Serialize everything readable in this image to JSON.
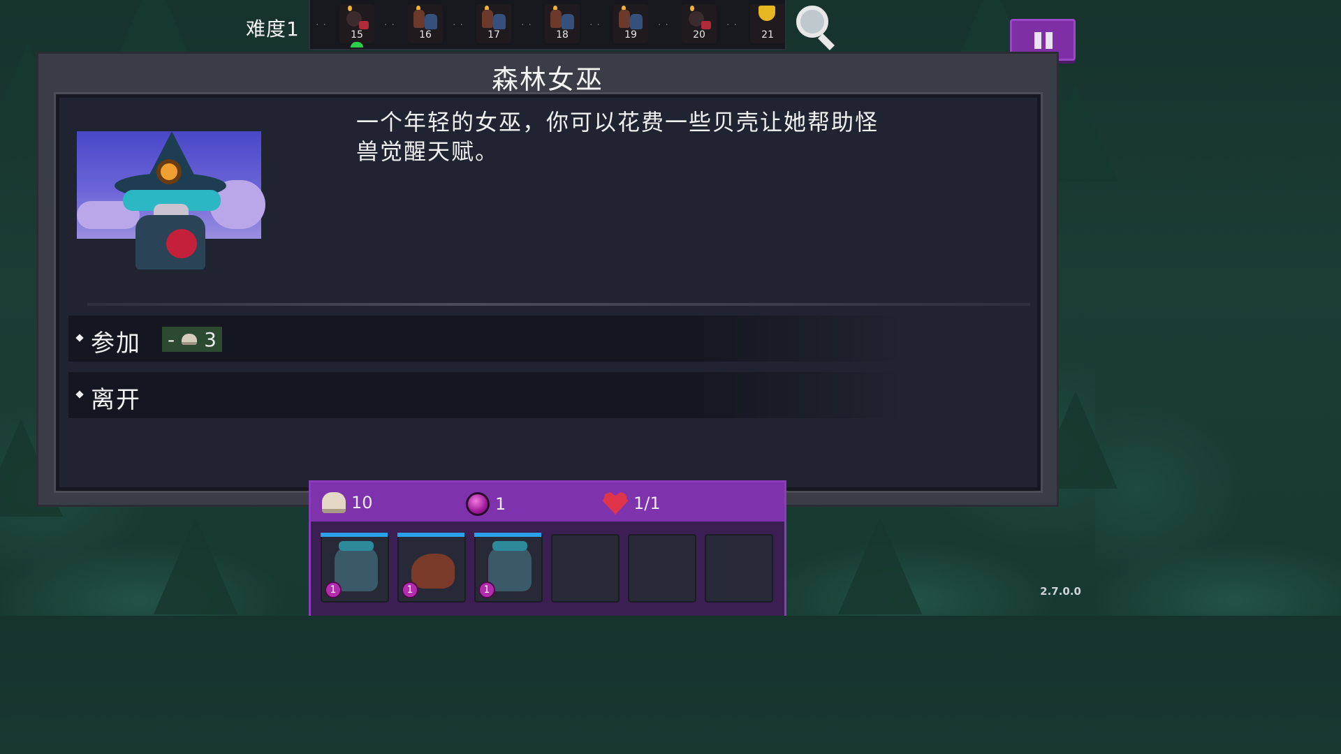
{
  "header": {
    "difficulty_label": "难度1",
    "waves": [
      {
        "number": "15",
        "kind": "bomb",
        "current": true
      },
      {
        "number": "16",
        "kind": "enemies",
        "current": false
      },
      {
        "number": "17",
        "kind": "enemies",
        "current": false
      },
      {
        "number": "18",
        "kind": "enemies",
        "current": false
      },
      {
        "number": "19",
        "kind": "enemies",
        "current": false
      },
      {
        "number": "20",
        "kind": "bomb",
        "current": false
      },
      {
        "number": "21",
        "kind": "trophy",
        "current": false
      }
    ],
    "search_icon": "magnifier-icon",
    "pause_icon": "pause-icon"
  },
  "event": {
    "title": "森林女巫",
    "description_line1": "一个年轻的女巫，你可以花费一些贝壳让她帮助怪",
    "description_line2": "兽觉醒天赋。",
    "portrait": "forest-witch-portrait",
    "options": [
      {
        "label": "参加",
        "cost_prefix": "-",
        "cost_value": "3",
        "cost_icon": "shell-icon"
      },
      {
        "label": "离开"
      }
    ]
  },
  "inventory": {
    "shells": "10",
    "orbs": "1",
    "lives": "1/1",
    "slots": [
      {
        "occupied": true,
        "creature": "spiky-beast",
        "level": "1",
        "hp": 1.0
      },
      {
        "occupied": true,
        "creature": "boar",
        "level": "1",
        "hp": 1.0
      },
      {
        "occupied": true,
        "creature": "spiky-beast-vine",
        "level": "1",
        "hp": 1.0
      },
      {
        "occupied": false
      },
      {
        "occupied": false
      },
      {
        "occupied": false
      }
    ]
  },
  "version": "2.7.0.0",
  "colors": {
    "panel": "#3a3c46",
    "panel_inner": "#202430",
    "inventory_purple": "#6f2a9c",
    "pause_purple": "#7e2fa6",
    "hp_blue": "#2aa0e8",
    "current_wave_green": "#2bd04a"
  }
}
